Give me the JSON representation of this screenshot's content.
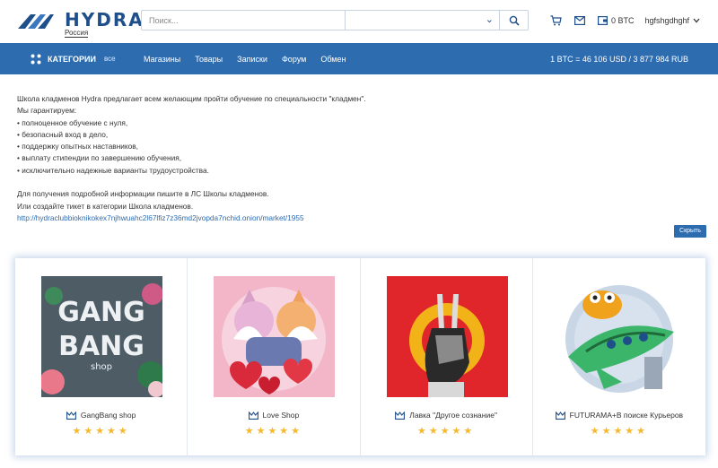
{
  "brand": {
    "name": "HYDRA",
    "region": "Россия"
  },
  "search": {
    "placeholder": "Поиск...",
    "select_value": ""
  },
  "header": {
    "balance": "0 BTC",
    "username": "hgfshgdhghf"
  },
  "nav": {
    "categories_label": "КАТЕГОРИИ",
    "all_label": "все",
    "links": [
      "Магазины",
      "Товары",
      "Записки",
      "Форум",
      "Обмен"
    ],
    "rate": "1 BTC = 46 106 USD / 3 877 984 RUB"
  },
  "notice": {
    "lines": [
      "Школа кладменов Hydra предлагает всем желающим пройти обучение по специальности \"кладмен\".",
      "Мы гарантируем:",
      "• полноценное обучение с нуля,",
      "• безопасный вход в дело,",
      "• поддержку опытных наставников,",
      "• выплату стипендии по завершению обучения,",
      "• исключительно надежные варианты трудоустройства."
    ],
    "lines2": [
      "Для получения подробной информации пишите в ЛС Школы кладменов.",
      "Или создайте тикет в категории Школа кладменов."
    ],
    "link": "http://hydraclubbioknikokex7njhwuahc2l67lfiz7z36md2jvopda7nchid.onion/market/1955",
    "hide_button": "Скрыть"
  },
  "shops": [
    {
      "name": "GangBang shop",
      "rating": 5,
      "logo_text": [
        "GANG",
        "BANG",
        "shop"
      ]
    },
    {
      "name": "Love Shop",
      "rating": 5
    },
    {
      "name": "Лавка \"Другое сознание\"",
      "rating": 5
    },
    {
      "name": "FUTURAMA+В поиске Курьеров",
      "rating": 5
    }
  ],
  "colors": {
    "primary": "#2e6cb0",
    "star": "#f5b82e",
    "brand_text": "#1f4f8a"
  }
}
